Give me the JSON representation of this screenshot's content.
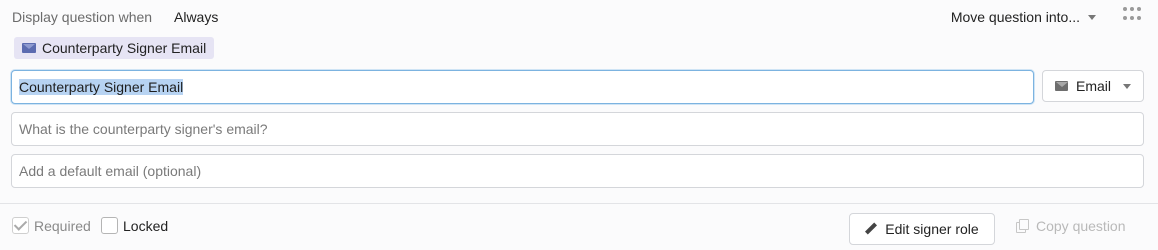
{
  "condition": {
    "label": "Display question when",
    "value": "Always"
  },
  "move_menu": {
    "label": "Move question into..."
  },
  "chip": {
    "icon": "envelope-icon",
    "label": "Counterparty Signer Email"
  },
  "fields": {
    "label_value": "Counterparty Signer Email",
    "question_placeholder": "What is the counterparty signer's email?",
    "default_placeholder": "Add a default email (optional)"
  },
  "type_select": {
    "icon": "envelope-icon",
    "value": "Email"
  },
  "footer": {
    "required_label": "Required",
    "required_checked": true,
    "locked_label": "Locked",
    "locked_checked": false,
    "edit_role_label": "Edit signer role",
    "copy_label": "Copy question"
  },
  "colors": {
    "chip_background": "#e6e4f4",
    "selection_highlight": "#b7d3f2",
    "focus_border": "#7cb3e0"
  }
}
